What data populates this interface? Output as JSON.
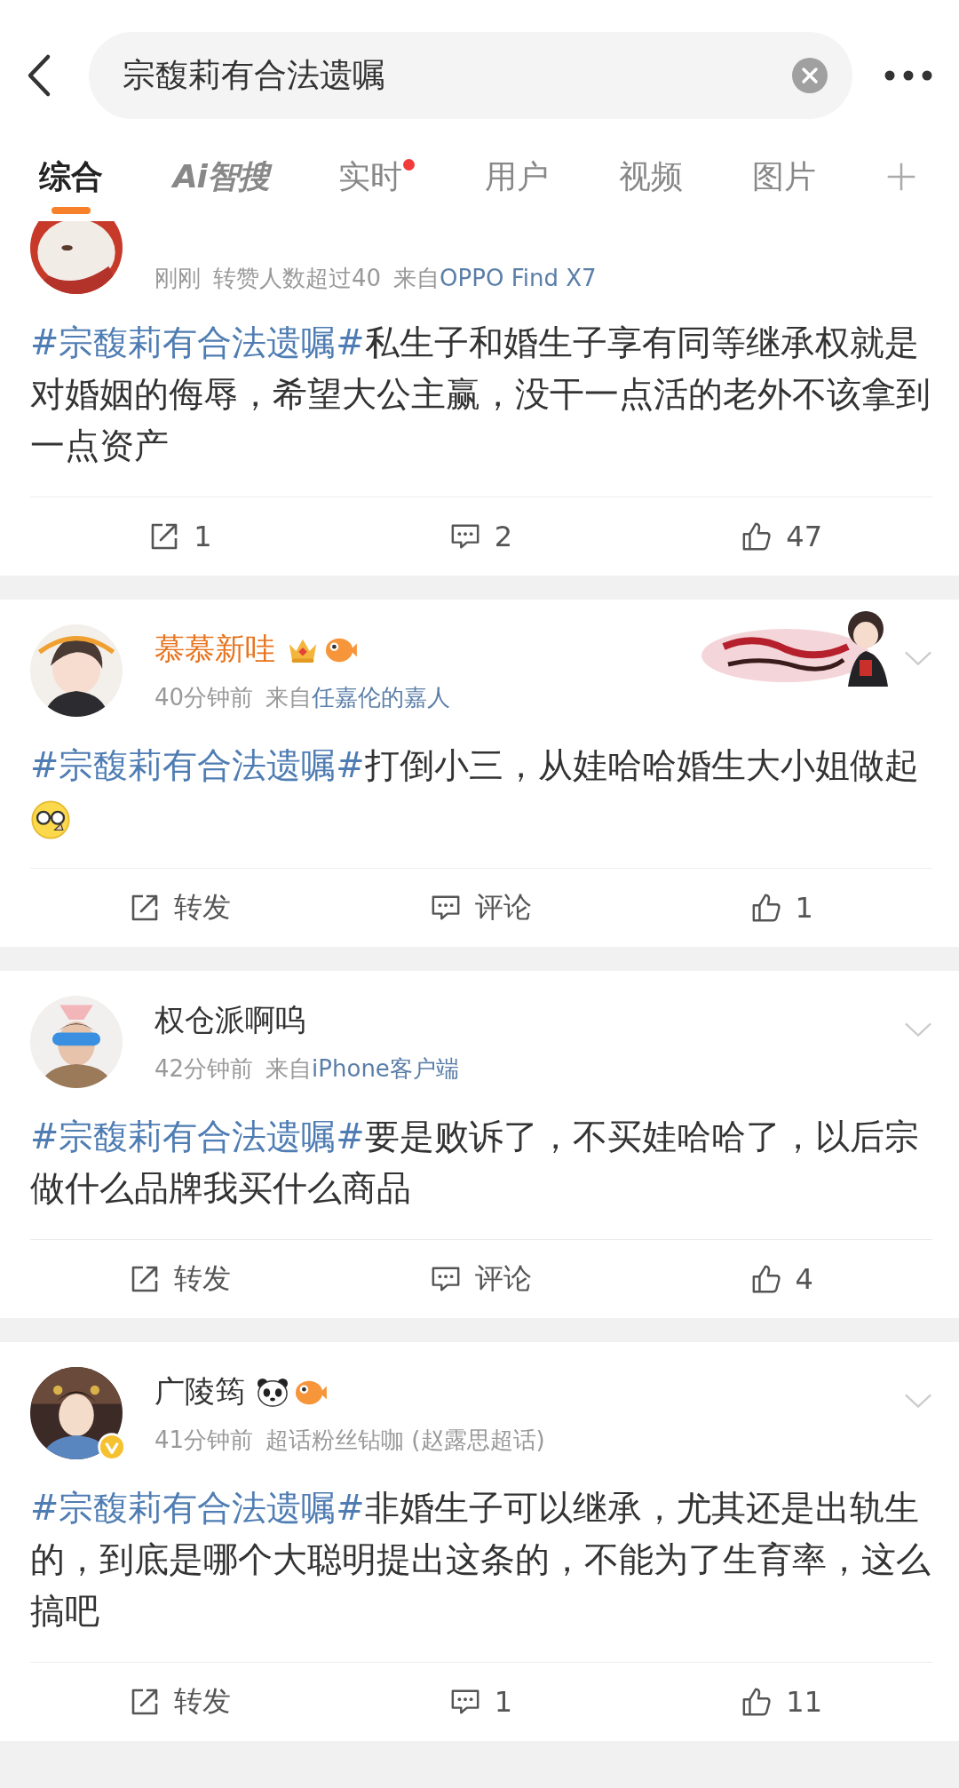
{
  "search": {
    "value": "宗馥莉有合法遗嘱"
  },
  "tabs": [
    {
      "label": "综合",
      "kind": "text",
      "selected": true,
      "dot": false
    },
    {
      "label": "Ai智搜",
      "kind": "ai",
      "selected": false,
      "dot": false
    },
    {
      "label": "实时",
      "kind": "text",
      "selected": false,
      "dot": true
    },
    {
      "label": "用户",
      "kind": "text",
      "selected": false,
      "dot": false
    },
    {
      "label": "视频",
      "kind": "text",
      "selected": false,
      "dot": false
    },
    {
      "label": "图片",
      "kind": "text",
      "selected": false,
      "dot": false
    }
  ],
  "posts": [
    {
      "meta": [
        {
          "text": "刚刚",
          "kind": "plain"
        },
        {
          "text": "转赞人数超过40",
          "kind": "plain"
        },
        {
          "text": "来自",
          "kind": "plain"
        },
        {
          "text": "OPPO Find X7",
          "kind": "link"
        }
      ],
      "hashtag": "#宗馥莉有合法遗嘱#",
      "text": "私生子和婚生子享有同等继承权就是对婚姻的侮辱，希望大公主赢，没干一点活的老外不该拿到一点资产",
      "actions": {
        "repost": "1",
        "comment": "2",
        "like": "47"
      }
    },
    {
      "name": "慕慕新哇",
      "vip": true,
      "menu": true,
      "decoration": true,
      "badges": [
        {
          "kind": "crown"
        },
        {
          "kind": "fish"
        }
      ],
      "meta": [
        {
          "text": "40分钟前",
          "kind": "plain"
        },
        {
          "text": "来自",
          "kind": "plain"
        },
        {
          "text": "任嘉伦的嘉人",
          "kind": "link"
        }
      ],
      "hashtag": "#宗馥莉有合法遗嘱#",
      "text": "打倒小三，从娃哈哈婚生大小姐做起",
      "emoji": true,
      "actions": {
        "repost": "转发",
        "comment": "评论",
        "like": "1"
      }
    },
    {
      "name": "权仓派啊呜",
      "menu": true,
      "meta": [
        {
          "text": "42分钟前",
          "kind": "plain"
        },
        {
          "text": "来自",
          "kind": "plain"
        },
        {
          "text": "iPhone客户端",
          "kind": "link"
        }
      ],
      "hashtag": "#宗馥莉有合法遗嘱#",
      "text": "要是败诉了，不买娃哈哈了，以后宗做什么品牌我买什么商品",
      "actions": {
        "repost": "转发",
        "comment": "评论",
        "like": "4"
      }
    },
    {
      "name": "广陵筠",
      "menu": true,
      "verified": true,
      "badges": [
        {
          "kind": "panda"
        },
        {
          "kind": "fish"
        }
      ],
      "meta": [
        {
          "text": "41分钟前",
          "kind": "plain"
        },
        {
          "text": "超话粉丝钻咖 (赵露思超话)",
          "kind": "plain"
        }
      ],
      "hashtag": "#宗馥莉有合法遗嘱#",
      "text": "非婚生子可以继承，尤其还是出轨生的，到底是哪个大聪明提出这条的，不能为了生育率，这么搞吧",
      "actions": {
        "repost": "转发",
        "comment": "1",
        "like": "11"
      }
    }
  ]
}
